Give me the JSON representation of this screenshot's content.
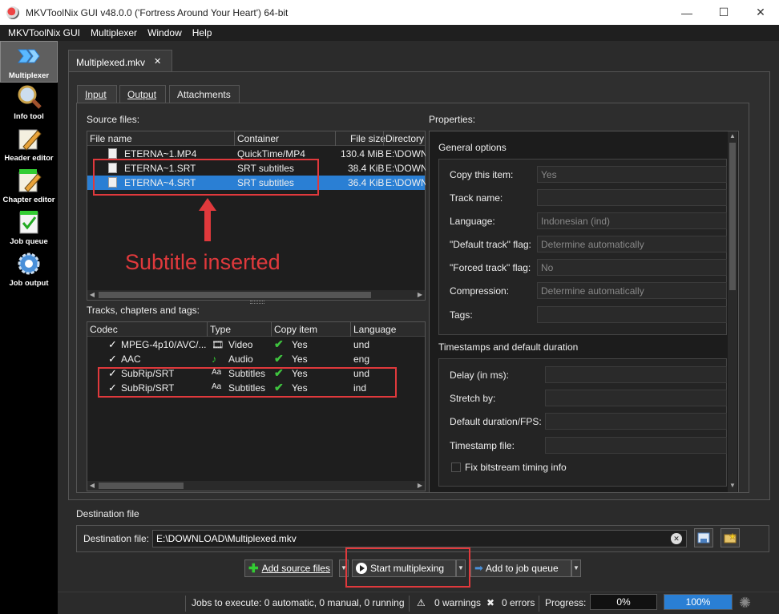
{
  "window": {
    "title": "MKVToolNix GUI v48.0.0 ('Fortress Around Your Heart') 64-bit",
    "minimize": "—",
    "maximize": "☐",
    "close": "✕"
  },
  "menu": [
    "MKVToolNix GUI",
    "Multiplexer",
    "Window",
    "Help"
  ],
  "sidebar": [
    {
      "label": "Multiplexer",
      "icon": "multiplexer-icon"
    },
    {
      "label": "Info tool",
      "icon": "magnifier-icon"
    },
    {
      "label": "Header editor",
      "icon": "pencil-icon"
    },
    {
      "label": "Chapter editor",
      "icon": "notepad-icon"
    },
    {
      "label": "Job queue",
      "icon": "checklist-icon"
    },
    {
      "label": "Job output",
      "icon": "gear-icon"
    }
  ],
  "doc_tab": {
    "label": "Multiplexed.mkv",
    "close": "✕"
  },
  "subtabs": [
    "Input",
    "Output",
    "Attachments"
  ],
  "source_files": {
    "label": "Source files:",
    "columns": [
      "File name",
      "Container",
      "File size",
      "Directory"
    ],
    "rows": [
      {
        "name": "ETERNA~1.MP4",
        "container": "QuickTime/MP4",
        "size": "130.4 MiB",
        "dir": "E:\\DOWN"
      },
      {
        "name": "ETERNA~1.SRT",
        "container": "SRT subtitles",
        "size": "38.4 KiB",
        "dir": "E:\\DOWN"
      },
      {
        "name": "ETERNA~4.SRT",
        "container": "SRT subtitles",
        "size": "36.4 KiB",
        "dir": "E:\\DOWN"
      }
    ]
  },
  "annotation": {
    "text": "Subtitle inserted",
    "arrow": "↑",
    "color": "#e0393c"
  },
  "tracks": {
    "label": "Tracks, chapters and tags:",
    "columns": [
      "Codec",
      "Type",
      "Copy item",
      "Language"
    ],
    "rows": [
      {
        "checked": "✓",
        "codec": "MPEG-4p10/AVC/...",
        "type": "Video",
        "type_icon": "film-icon",
        "copy": "Yes",
        "lang": "und"
      },
      {
        "checked": "✓",
        "codec": "AAC",
        "type": "Audio",
        "type_icon": "music-note-icon",
        "copy": "Yes",
        "lang": "eng"
      },
      {
        "checked": "✓",
        "codec": "SubRip/SRT",
        "type": "Subtitles",
        "type_icon": "subtitle-icon",
        "copy": "Yes",
        "lang": "und"
      },
      {
        "checked": "✓",
        "codec": "SubRip/SRT",
        "type": "Subtitles",
        "type_icon": "subtitle-icon",
        "copy": "Yes",
        "lang": "ind"
      }
    ]
  },
  "properties": {
    "label": "Properties:",
    "general": {
      "title": "General options",
      "fields": [
        {
          "label": "Copy this item:",
          "value": "Yes"
        },
        {
          "label": "Track name:",
          "value": ""
        },
        {
          "label": "Language:",
          "value": "Indonesian (ind)"
        },
        {
          "label": "\"Default track\" flag:",
          "value": "Determine automatically"
        },
        {
          "label": "\"Forced track\" flag:",
          "value": "No"
        },
        {
          "label": "Compression:",
          "value": "Determine automatically"
        },
        {
          "label": "Tags:",
          "value": ""
        }
      ]
    },
    "timestamps": {
      "title": "Timestamps and default duration",
      "fields": [
        {
          "label": "Delay (in ms):",
          "value": ""
        },
        {
          "label": "Stretch by:",
          "value": ""
        },
        {
          "label": "Default duration/FPS:",
          "value": ""
        },
        {
          "label": "Timestamp file:",
          "value": ""
        }
      ],
      "checkbox": "Fix bitstream timing info"
    }
  },
  "destination": {
    "section": "Destination file",
    "label": "Destination file:",
    "value": "E:\\DOWNLOAD\\Multiplexed.mkv",
    "clear": "✕"
  },
  "buttons": {
    "add_source": "Add source files",
    "start": "Start multiplexing",
    "add_queue": "Add to job queue"
  },
  "status": {
    "jobs": "Jobs to execute:  0 automatic, 0 manual, 0 running",
    "warnings": "0 warnings",
    "errors": "0 errors",
    "progress_label": "Progress:",
    "progress_current": "0%",
    "progress_total": "100%",
    "progress_current_fraction": 0,
    "progress_total_fraction": 1
  }
}
